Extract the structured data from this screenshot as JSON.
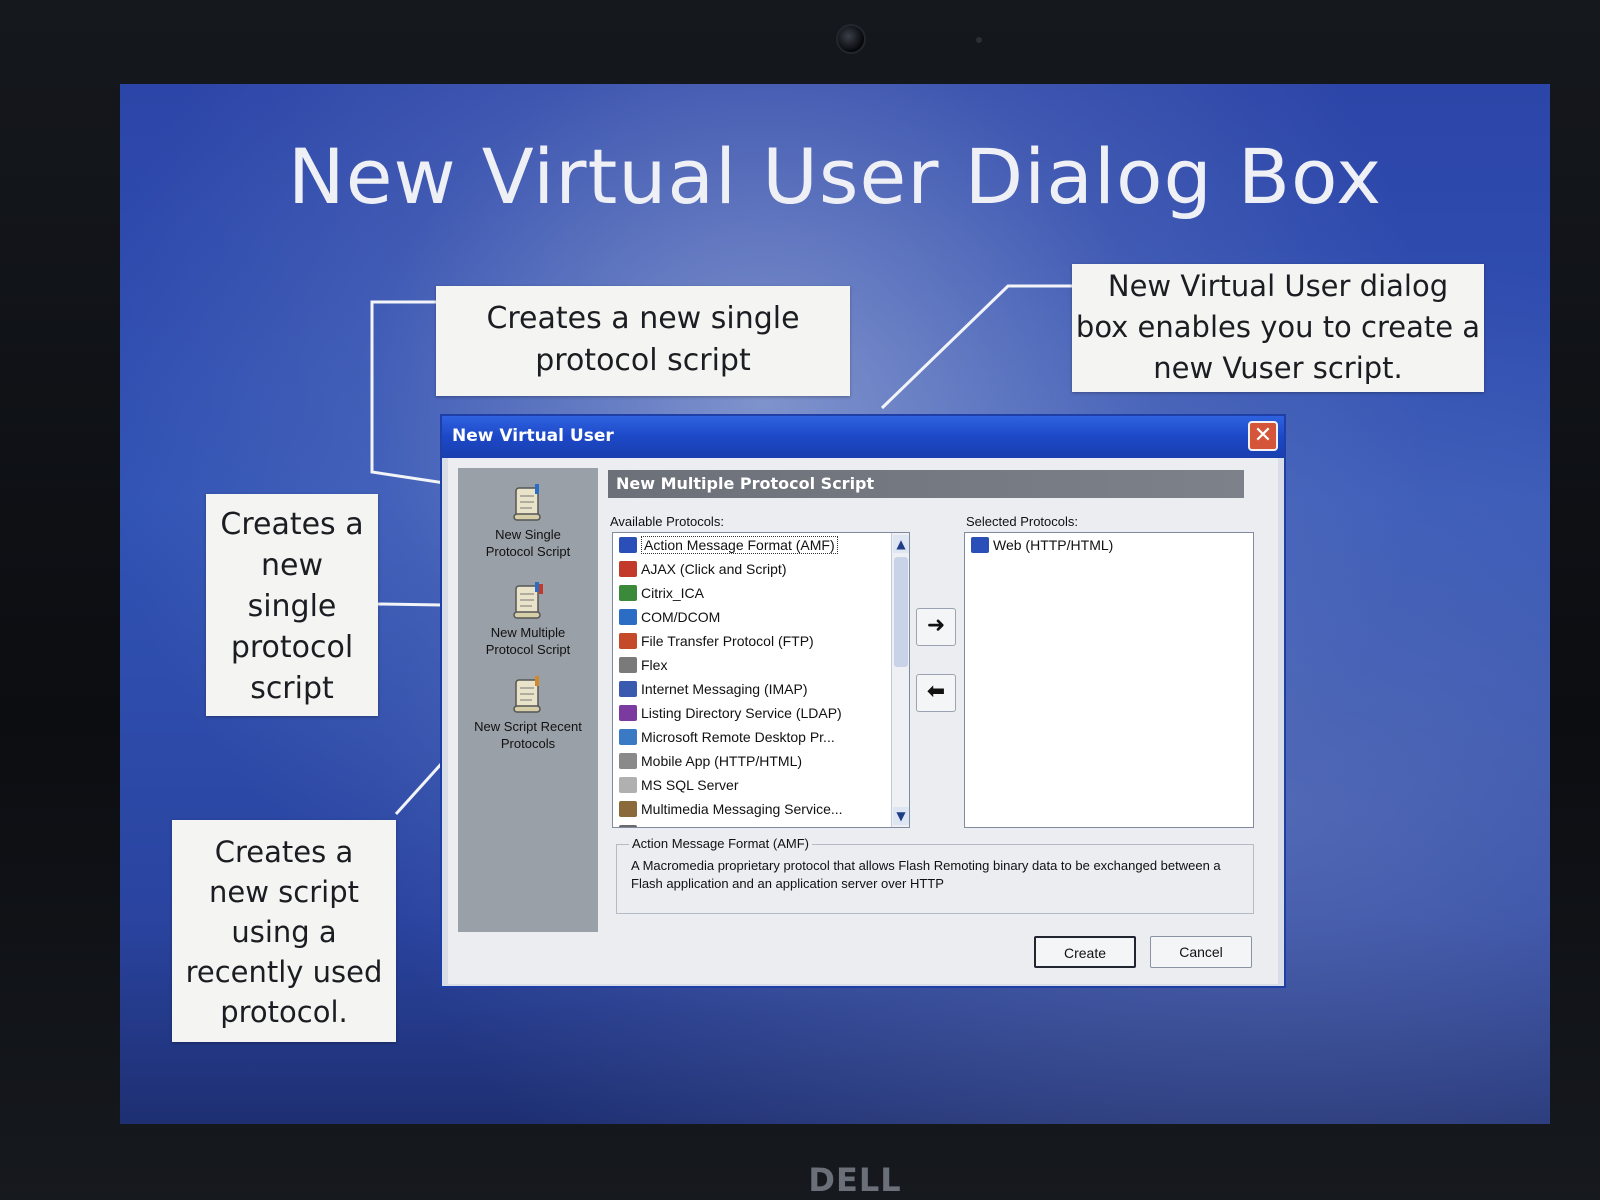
{
  "slide": {
    "title": "New Virtual User Dialog Box"
  },
  "callouts": {
    "single_top": [
      "Creates a new single",
      "protocol script"
    ],
    "dialog_info": [
      "New Virtual User dialog",
      "box enables you to create a",
      "new Vuser script."
    ],
    "left_single": [
      "Creates a",
      "new",
      "single",
      "protocol",
      "script"
    ],
    "recent": [
      "Creates a",
      "new script",
      "using a",
      "recently used",
      "protocol."
    ]
  },
  "dialog": {
    "title": "New Virtual User",
    "close_label": "✕",
    "left_panel": [
      {
        "label_lines": [
          "New Single",
          "Protocol Script"
        ],
        "icon": "scroll-icon"
      },
      {
        "label_lines": [
          "New Multiple",
          "Protocol Script"
        ],
        "icon": "scroll-icon"
      },
      {
        "label_lines": [
          "New Script Recent",
          "Protocols"
        ],
        "icon": "scroll-icon"
      }
    ],
    "section_header": "New Multiple Protocol Script",
    "available_label": "Available Protocols:",
    "selected_label": "Selected Protocols:",
    "available_protocols": [
      {
        "label": "Action Message Format (AMF)",
        "color": "#2b4fb8",
        "selected": true
      },
      {
        "label": "AJAX (Click and Script)",
        "color": "#c23a2a"
      },
      {
        "label": "Citrix_ICA",
        "color": "#3a8a3a"
      },
      {
        "label": "COM/DCOM",
        "color": "#2b6cc4"
      },
      {
        "label": "File Transfer Protocol (FTP)",
        "color": "#c44a2a"
      },
      {
        "label": "Flex",
        "color": "#7a7a7a"
      },
      {
        "label": "Internet Messaging (IMAP)",
        "color": "#3a5ab0"
      },
      {
        "label": "Listing Directory Service (LDAP)",
        "color": "#7a3aa0"
      },
      {
        "label": "Microsoft Remote Desktop Pr...",
        "color": "#3a7ac4"
      },
      {
        "label": "Mobile App (HTTP/HTML)",
        "color": "#8a8a8a"
      },
      {
        "label": "MS SQL Server",
        "color": "#b0b0b0"
      },
      {
        "label": "Multimedia Messaging Service...",
        "color": "#8a6a3a"
      },
      {
        "label": "ODBC",
        "color": "#6a6a6a"
      }
    ],
    "selected_protocols": [
      {
        "label": "Web (HTTP/HTML)",
        "color": "#2b4fb8"
      }
    ],
    "add_arrow": "➜",
    "remove_arrow": "⬅",
    "description": {
      "title": "Action Message Format (AMF)",
      "text": "A Macromedia proprietary protocol that allows Flash Remoting binary data to be exchanged between a Flash application and an application server over HTTP"
    },
    "buttons": {
      "create": "Create",
      "cancel": "Cancel"
    }
  },
  "laptop": {
    "brand": "DELL"
  },
  "colors": {
    "slide_blue": "#2c45a8",
    "titlebar_blue": "#1c48c7",
    "callout_bg": "#f4f5f2"
  }
}
